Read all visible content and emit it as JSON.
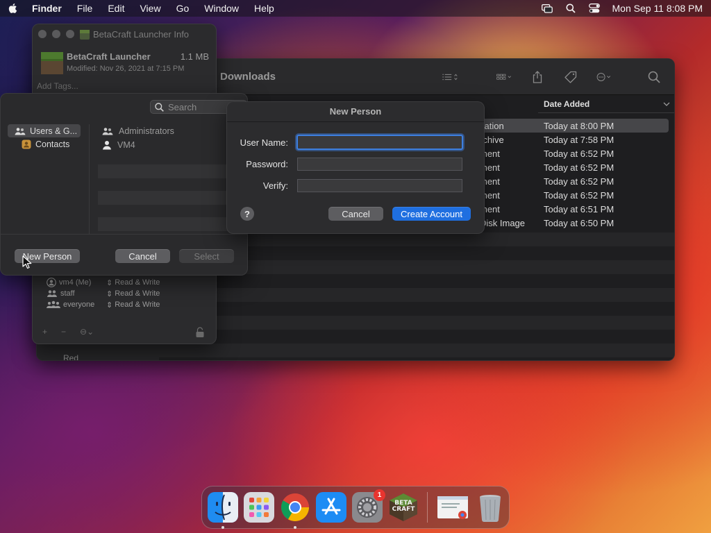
{
  "menubar": {
    "app_name": "Finder",
    "items": [
      "File",
      "Edit",
      "View",
      "Go",
      "Window",
      "Help"
    ],
    "datetime": "Mon Sep 11  8:08 PM",
    "icons": [
      "apple-icon",
      "screen-mirroring-icon",
      "spotlight-search-icon",
      "control-center-icon"
    ]
  },
  "finder": {
    "title": "Downloads",
    "column_header": "Date Added",
    "rows": [
      {
        "kind": "cation",
        "date": "Today at 8:00 PM",
        "selected": true
      },
      {
        "kind": "rchive",
        "date": "Today at 7:58 PM"
      },
      {
        "kind": "ment",
        "date": "Today at 6:52 PM"
      },
      {
        "kind": "ment",
        "date": "Today at 6:52 PM"
      },
      {
        "kind": "ment",
        "date": "Today at 6:52 PM"
      },
      {
        "kind": "ment",
        "date": "Today at 6:52 PM"
      },
      {
        "kind": "ment",
        "date": "Today at 6:51 PM"
      },
      {
        "kind": "Disk Image",
        "date": "Today at 6:50 PM"
      }
    ],
    "sidebar_partial": "Red"
  },
  "info_window": {
    "title": "BetaCraft Launcher Info",
    "app_name": "BetaCraft Launcher",
    "size": "1.1 MB",
    "modified": "Modified: Nov 26, 2021 at 7:15 PM",
    "tags_placeholder": "Add Tags...",
    "permissions": [
      {
        "name": "vm4 (Me)",
        "privilege": "Read & Write"
      },
      {
        "name": "staff",
        "privilege": "Read & Write"
      },
      {
        "name": "everyone",
        "privilege": "Read & Write"
      }
    ]
  },
  "users_panel": {
    "search_placeholder": "Search",
    "sources": [
      {
        "label": "Users & G...",
        "selected": true
      },
      {
        "label": "Contacts"
      }
    ],
    "entries": [
      "Administrators",
      "VM4"
    ],
    "buttons": {
      "new_person": "New Person",
      "cancel": "Cancel",
      "select": "Select"
    }
  },
  "new_person": {
    "title": "New Person",
    "username_label": "User Name:",
    "password_label": "Password:",
    "verify_label": "Verify:",
    "username_value": "",
    "password_value": "",
    "verify_value": "",
    "help": "?",
    "cancel": "Cancel",
    "create": "Create Account"
  },
  "dock": {
    "apps": [
      "finder",
      "launchpad",
      "chrome",
      "app-store",
      "system-settings",
      "betacraft",
      "chrome-window",
      "trash"
    ],
    "settings_badge": "1",
    "betacraft_label": "BETA CRAFT"
  },
  "colors": {
    "accent": "#1f6fe0",
    "badge": "#e8342f"
  }
}
